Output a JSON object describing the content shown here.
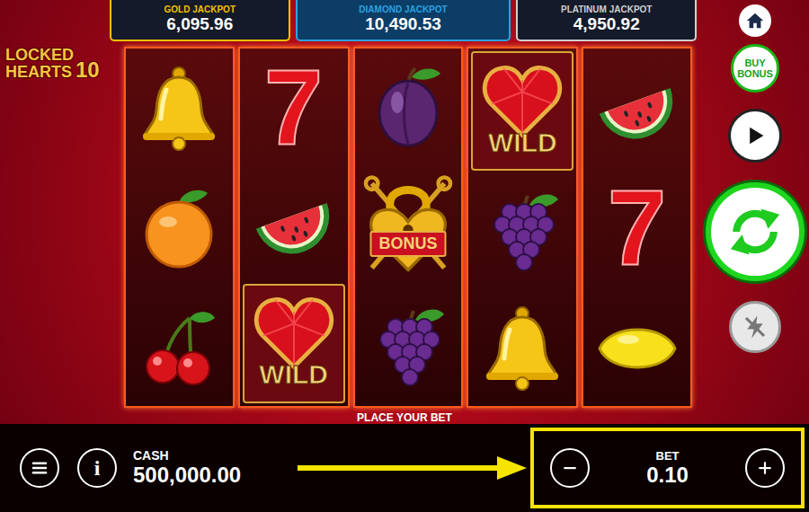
{
  "game": {
    "title_lines": [
      "LOCKED",
      "HEARTS"
    ],
    "title_number": "10"
  },
  "jackpots": [
    {
      "label": "GOLD JACKPOT",
      "value": "6,095.96",
      "color": "#f2c200"
    },
    {
      "label": "DIAMOND JACKPOT",
      "value": "10,490.53",
      "color": "#2aa3e0"
    },
    {
      "label": "PLATINUM JACKPOT",
      "value": "4,950.92",
      "color": "#d0d0d0"
    }
  ],
  "reels": [
    {
      "symbols": [
        {
          "kind": "bell"
        },
        {
          "kind": "orange"
        },
        {
          "kind": "cherry"
        }
      ]
    },
    {
      "symbols": [
        {
          "kind": "seven",
          "text": "7"
        },
        {
          "kind": "watermelon"
        },
        {
          "kind": "wild",
          "text": "WILD"
        }
      ]
    },
    {
      "symbols": [
        {
          "kind": "plum"
        },
        {
          "kind": "bonus",
          "text": "BONUS"
        },
        {
          "kind": "grape"
        }
      ]
    },
    {
      "symbols": [
        {
          "kind": "wild",
          "text": "WILD"
        },
        {
          "kind": "grape"
        },
        {
          "kind": "bell"
        }
      ]
    },
    {
      "symbols": [
        {
          "kind": "watermelon"
        },
        {
          "kind": "seven",
          "text": "7"
        },
        {
          "kind": "lemon"
        }
      ]
    }
  ],
  "message": "PLACE YOUR BET",
  "buy_bonus": [
    "BUY",
    "BONUS"
  ],
  "turbo_on": false,
  "info_glyph": "i",
  "cash": {
    "label": "CASH",
    "value": "500,000.00"
  },
  "bet": {
    "label": "BET",
    "value": "0.10",
    "highlighted": true
  }
}
